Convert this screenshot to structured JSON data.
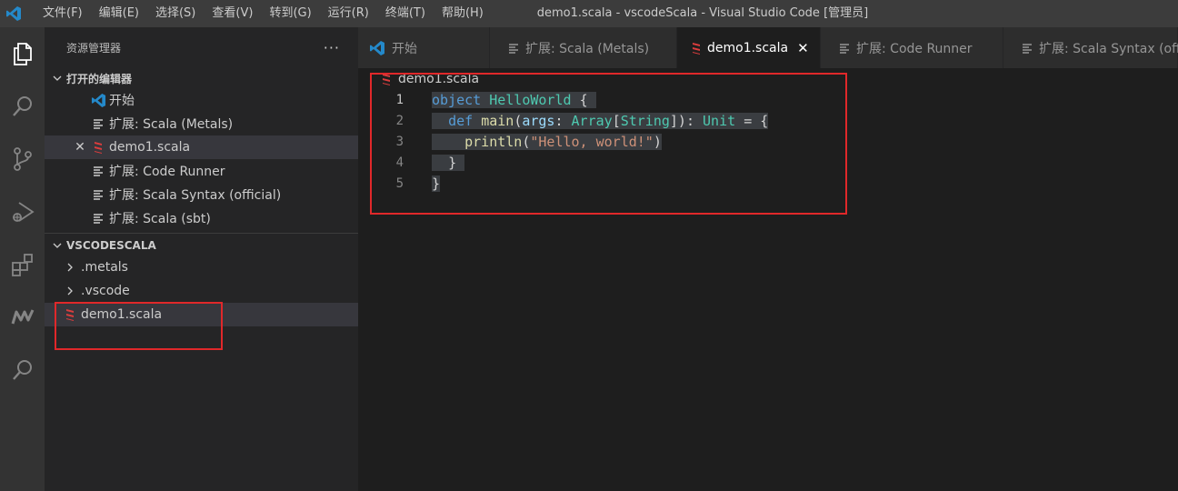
{
  "window": {
    "title": "demo1.scala - vscodeScala - Visual Studio Code [管理员]"
  },
  "menu": [
    "文件(F)",
    "编辑(E)",
    "选择(S)",
    "查看(V)",
    "转到(G)",
    "运行(R)",
    "终端(T)",
    "帮助(H)"
  ],
  "activity_bar": [
    "explorer-icon",
    "search-icon",
    "source-control-icon",
    "run-debug-icon",
    "extensions-icon",
    "metals-icon",
    "search-icon"
  ],
  "sidebar": {
    "title": "资源管理器",
    "more": "···",
    "open_editors": {
      "header": "打开的编辑器",
      "items": [
        {
          "label": "开始",
          "icon": "vscode-icon"
        },
        {
          "label": "扩展: Scala (Metals)",
          "icon": "extension-page-icon"
        },
        {
          "label": "demo1.scala",
          "icon": "scala-icon",
          "close": "✕"
        },
        {
          "label": "扩展: Code Runner",
          "icon": "extension-page-icon"
        },
        {
          "label": "扩展: Scala Syntax (official)",
          "icon": "extension-page-icon"
        },
        {
          "label": "扩展: Scala (sbt)",
          "icon": "extension-page-icon"
        }
      ]
    },
    "workspace": {
      "header": "VSCODESCALA",
      "items": [
        {
          "label": ".metals",
          "icon": "chevron-right-icon"
        },
        {
          "label": ".vscode",
          "icon": "chevron-right-icon"
        },
        {
          "label": "demo1.scala",
          "icon": "scala-icon"
        }
      ]
    }
  },
  "tabs": [
    {
      "label": "开始",
      "icon": "vscode-icon"
    },
    {
      "label": "扩展: Scala (Metals)",
      "icon": "extension-page-icon"
    },
    {
      "label": "demo1.scala",
      "icon": "scala-icon",
      "close": "✕"
    },
    {
      "label": "扩展: Code Runner",
      "icon": "extension-page-icon"
    },
    {
      "label": "扩展: Scala Syntax (offi",
      "icon": "extension-page-icon"
    }
  ],
  "editor": {
    "breadcrumb": "demo1.scala",
    "line_numbers": [
      "1",
      "2",
      "3",
      "4",
      "5"
    ],
    "code": {
      "l1": {
        "kw": "object",
        "name": "HelloWorld",
        "brace": "{"
      },
      "l2": {
        "kw": "def",
        "fn": "main",
        "p1": "(",
        "param": "args",
        "colon": ":",
        "t1": "Array",
        "b1": "[",
        "t2": "String",
        "b2": "])",
        "colon2": ":",
        "t3": "Unit",
        "eq": "=",
        "brace": "{"
      },
      "l3": {
        "fn": "println",
        "p1": "(",
        "str": "\"Hello, world!\"",
        "p2": ")"
      },
      "l4": {
        "brace": "}"
      },
      "l5": {
        "brace": "}"
      }
    }
  },
  "colors": {
    "annotation_red": "#e0282a",
    "scala_red": "#dc3d3d",
    "vscode_blue": "#2489ca"
  }
}
